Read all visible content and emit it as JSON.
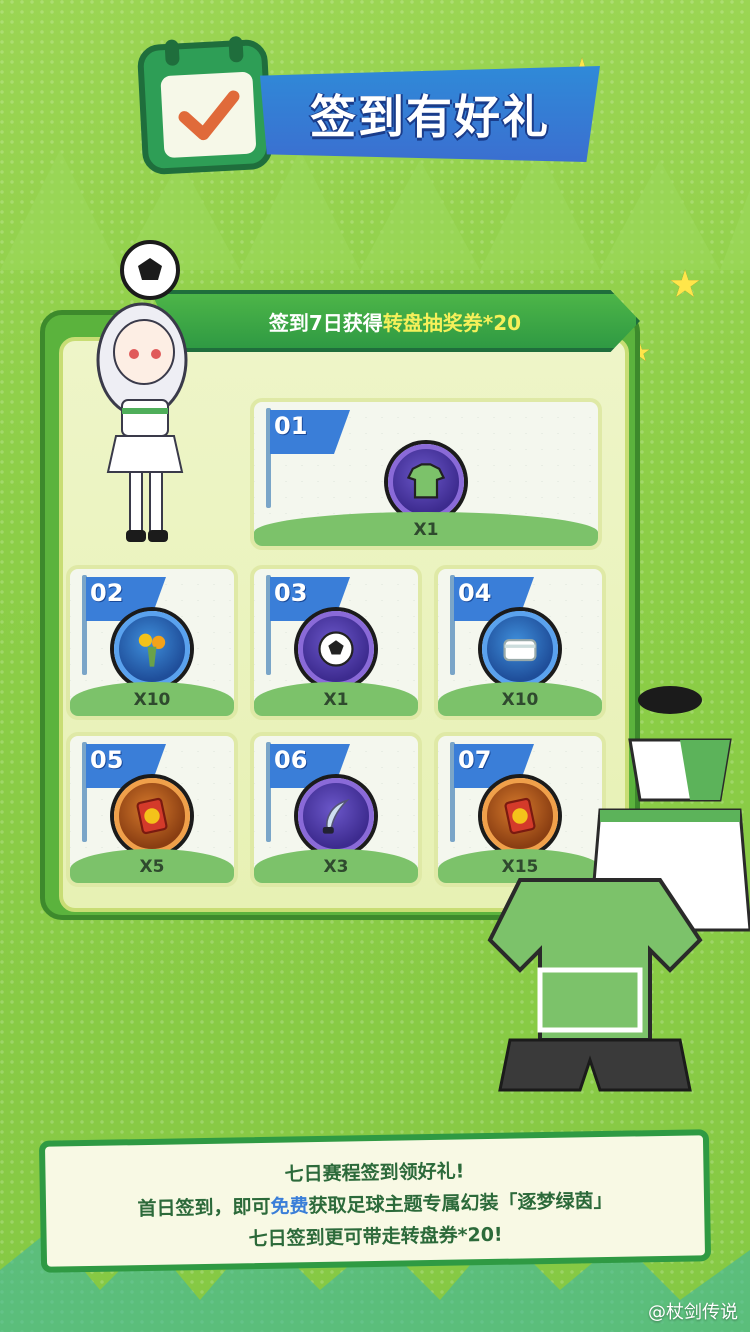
{
  "header": {
    "title": "签到有好礼"
  },
  "ribbon": {
    "prefix": "签到7日获得",
    "highlight": "转盘抽奖券*20"
  },
  "days": [
    {
      "day": "01",
      "qty": "X1",
      "icon": "jersey-icon",
      "ring": "purple"
    },
    {
      "day": "02",
      "qty": "X10",
      "icon": "flower-bouquet-icon",
      "ring": "blue"
    },
    {
      "day": "03",
      "qty": "X1",
      "icon": "soccer-ball-icon",
      "ring": "purple"
    },
    {
      "day": "04",
      "qty": "X10",
      "icon": "towel-icon",
      "ring": "blue"
    },
    {
      "day": "05",
      "qty": "X5",
      "icon": "lottery-ticket-icon",
      "ring": "orange"
    },
    {
      "day": "06",
      "qty": "X3",
      "icon": "feather-quill-icon",
      "ring": "purple"
    },
    {
      "day": "07",
      "qty": "X15",
      "icon": "lottery-ticket-icon",
      "ring": "orange"
    }
  ],
  "info": {
    "line1": "七日赛程签到领好礼!",
    "line2_prefix": "首日签到，即可",
    "line2_highlight": "免费",
    "line2_suffix": "获取足球主题专属幻装「逐梦绿茵」",
    "line3": "七日签到更可带走转盘券*20!"
  },
  "watermark": "@杖剑传说",
  "colors": {
    "background": "#8fd04a",
    "accent_green": "#2f9a43",
    "accent_blue": "#3a7ed8",
    "highlight_yellow": "#f5f05a"
  }
}
